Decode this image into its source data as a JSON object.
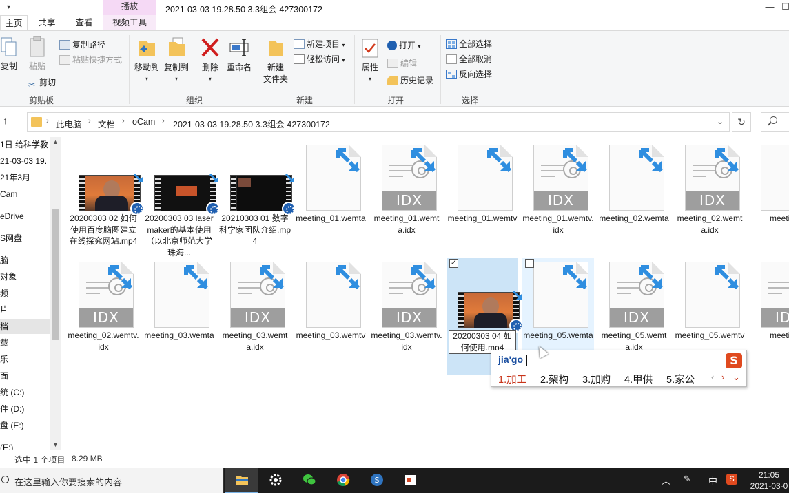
{
  "window": {
    "title": "2021-03-03 19.28.50 3.3组会 427300172",
    "context_tab": "播放",
    "controls": [
      "minimize",
      "maximize"
    ]
  },
  "tabs": [
    {
      "label": "主页",
      "active": true
    },
    {
      "label": "共享",
      "active": false
    },
    {
      "label": "查看",
      "active": false
    },
    {
      "label": "视频工具",
      "active": false,
      "contextual": true
    }
  ],
  "ribbon": {
    "clipboard": {
      "copy": "复制",
      "paste": "粘贴",
      "copy_path": "复制路径",
      "paste_shortcut": "粘贴快捷方式",
      "cut": "剪切",
      "group": "剪贴板"
    },
    "organize": {
      "move_to": "移动到",
      "copy_to": "复制到",
      "delete": "删除",
      "rename": "重命名",
      "group": "组织"
    },
    "new": {
      "new_folder_line1": "新建",
      "new_folder_line2": "文件夹",
      "new_item": "新建项目",
      "easy_access": "轻松访问",
      "group": "新建"
    },
    "open": {
      "properties": "属性",
      "open": "打开",
      "edit": "编辑",
      "history": "历史记录",
      "group": "打开"
    },
    "select": {
      "select_all": "全部选择",
      "select_none": "全部取消",
      "invert": "反向选择",
      "group": "选择"
    }
  },
  "address": {
    "crumbs": [
      "此电脑",
      "文档",
      "oCam",
      "2021-03-03 19.28.50 3.3组会 427300172"
    ]
  },
  "nav": {
    "items": [
      {
        "label": "1日 给科学教"
      },
      {
        "label": "21-03-03 19."
      },
      {
        "label": "21年3月"
      },
      {
        "label": "Cam"
      },
      {
        "label": "eDrive"
      },
      {
        "label": "S网盘"
      },
      {
        "label": "脑"
      },
      {
        "label": " 对象"
      },
      {
        "label": "频"
      },
      {
        "label": "片"
      },
      {
        "label": "档",
        "selected": true
      },
      {
        "label": "载"
      },
      {
        "label": "乐"
      },
      {
        "label": "面"
      },
      {
        "label": "统 (C:)"
      },
      {
        "label": "件 (D:)"
      },
      {
        "label": "盘 (E:)"
      },
      {
        "label": "(E:)"
      }
    ]
  },
  "files": [
    {
      "name": "20200303 02 如何使用百度脑图建立在线探究网站.mp4",
      "type": "video-person"
    },
    {
      "name": "20200303 03 lasermaker的基本使用（以北京师范大学珠海...",
      "type": "video-dark"
    },
    {
      "name": "20210303 01 数字科学家团队介绍.mp4",
      "type": "video-dark2"
    },
    {
      "name": "meeting_01.wemta",
      "type": "blank"
    },
    {
      "name": "meeting_01.wemta.idx",
      "type": "idx"
    },
    {
      "name": "meeting_01.wemtv",
      "type": "blank"
    },
    {
      "name": "meeting_01.wemtv.idx",
      "type": "idx"
    },
    {
      "name": "meeting_02.wemta",
      "type": "blank"
    },
    {
      "name": "meeting_02.wemta.idx",
      "type": "idx"
    },
    {
      "name": "meetin...",
      "type": "blank"
    },
    {
      "name": "meeting_02.wemtv.idx",
      "type": "idx"
    },
    {
      "name": "meeting_03.wemta",
      "type": "blank"
    },
    {
      "name": "meeting_03.wemta.idx",
      "type": "idx"
    },
    {
      "name": "meeting_03.wemtv",
      "type": "blank"
    },
    {
      "name": "meeting_03.wemtv.idx",
      "type": "idx"
    },
    {
      "name": "20200303 04 如何使用.mp4",
      "type": "video-person",
      "selected": true,
      "checked": true,
      "renaming": true
    },
    {
      "name": "meeting_05.wemta",
      "type": "blank",
      "hover": true,
      "checked": false
    },
    {
      "name": "meeting_05.wemta.idx",
      "type": "idx"
    },
    {
      "name": "meeting_05.wemtv",
      "type": "blank"
    },
    {
      "name": "meetin...",
      "type": "idx"
    }
  ],
  "ime": {
    "input": "jia'go",
    "candidates": [
      "1.加工",
      "2.架构",
      "3.加购",
      "4.甲供",
      "5.家公"
    ],
    "logo": "S"
  },
  "status": {
    "selection": "选中 1 个项目",
    "size": "8.29 MB"
  },
  "taskbar": {
    "search_placeholder": "在这里输入你要搜索的内容",
    "apps": [
      "file-explorer",
      "settings",
      "wechat",
      "chrome",
      "sogou",
      "presentation"
    ],
    "tray_ime": "中",
    "time": "21:05",
    "date": "2021-03-0"
  },
  "colors": {
    "ribbon_bg": "#f5f6f7",
    "selected_bg": "#cce4f7",
    "hover_bg": "#e5f3ff",
    "shortcut_arrow": "#2f8ee0",
    "ime_accent": "#c8341a",
    "context_tab": "#f5d9f5"
  }
}
